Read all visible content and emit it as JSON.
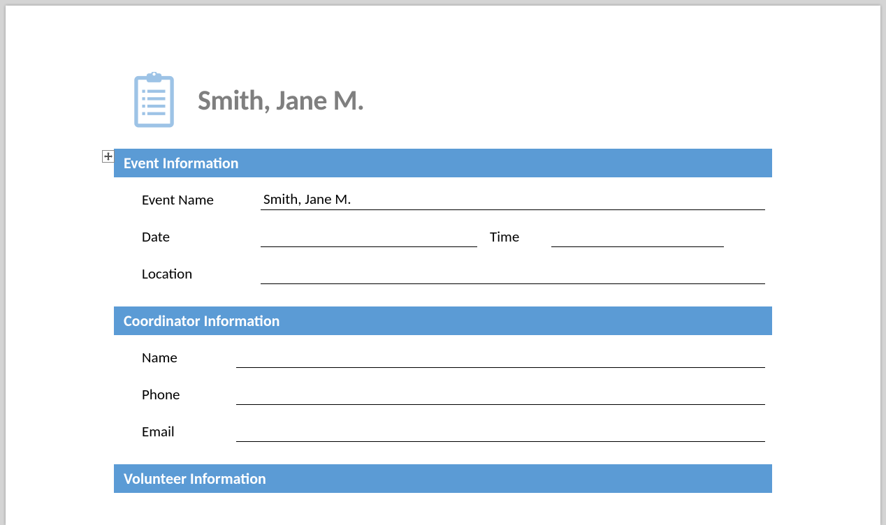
{
  "document": {
    "title": "Smith, Jane M."
  },
  "sections": {
    "event": {
      "heading": "Event Information",
      "fields": {
        "event_name_label": "Event Name",
        "event_name_value": "Smith, Jane M.",
        "date_label": "Date",
        "date_value": "",
        "time_label": "Time",
        "time_value": "",
        "location_label": "Location",
        "location_value": ""
      }
    },
    "coordinator": {
      "heading": "Coordinator Information",
      "fields": {
        "name_label": "Name",
        "name_value": "",
        "phone_label": "Phone",
        "phone_value": "",
        "email_label": "Email",
        "email_value": ""
      }
    },
    "volunteer": {
      "heading": "Volunteer Information"
    }
  }
}
